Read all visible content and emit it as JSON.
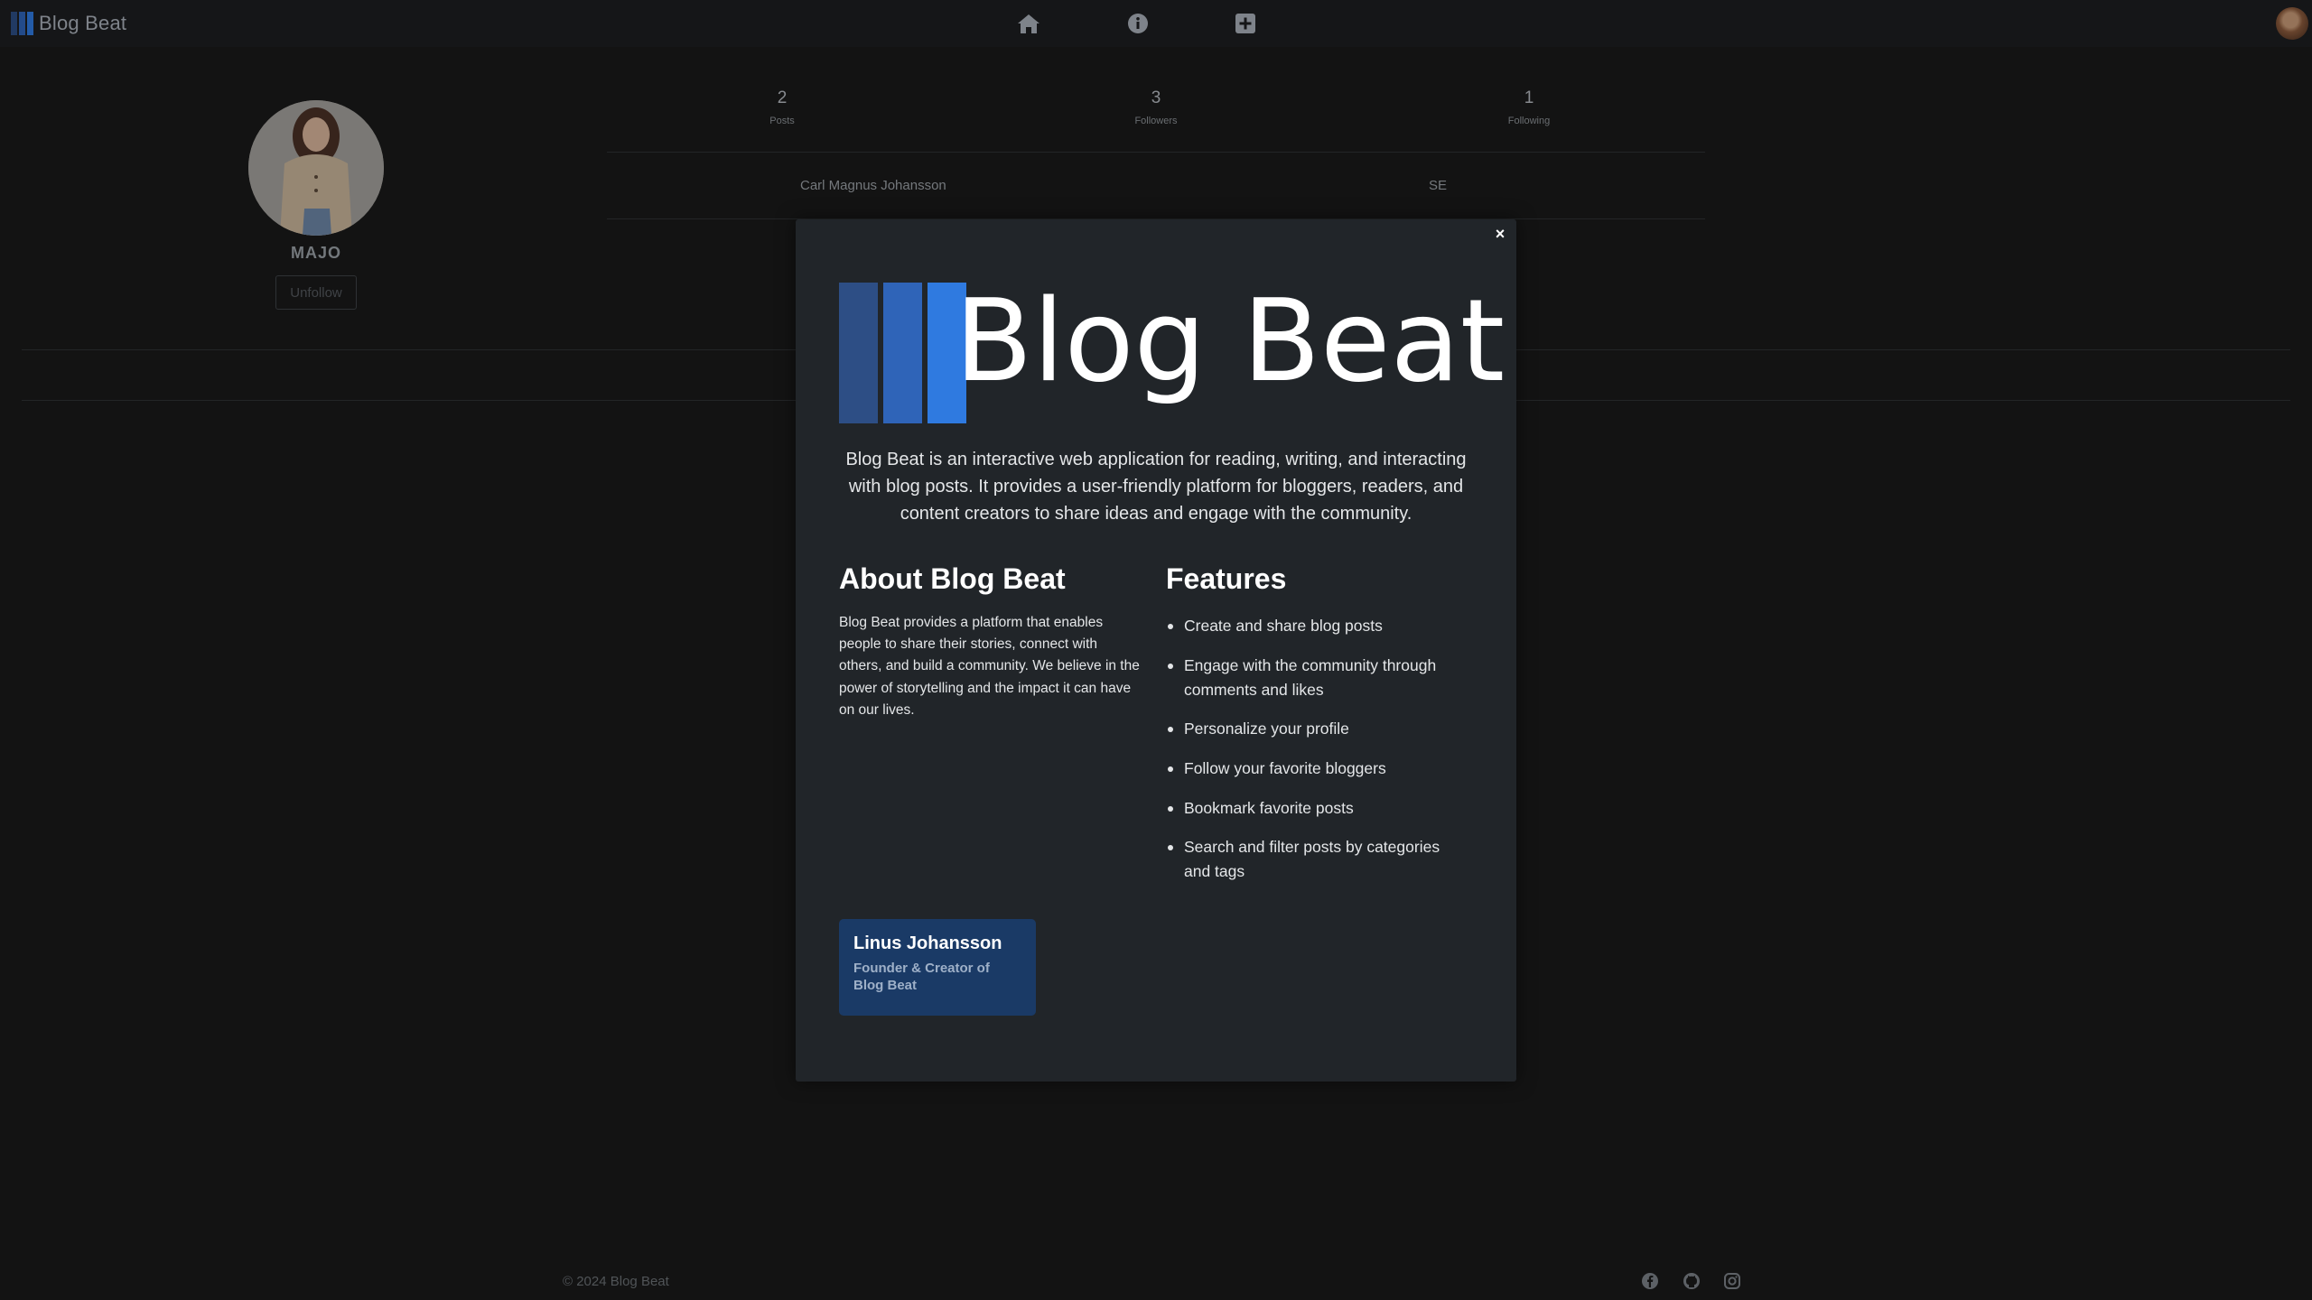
{
  "navbar": {
    "brand": "Blog Beat",
    "nav_icons": [
      "home-icon",
      "info-icon",
      "plus-square-icon"
    ]
  },
  "colors": {
    "bar1": "#2d4e85",
    "bar2": "#2f64b8",
    "bar3": "#2f7ae0",
    "founder_card": "#1a3a66",
    "modal_bg": "#212529"
  },
  "profile": {
    "username": "MAJO",
    "unfollow_label": "Unfollow",
    "stats": [
      {
        "value": "2",
        "label": "Posts"
      },
      {
        "value": "3",
        "label": "Followers"
      },
      {
        "value": "1",
        "label": "Following"
      }
    ],
    "full_name": "Carl Magnus Johansson",
    "country": "SE"
  },
  "modal": {
    "close_label": "×",
    "logo_text": "Blog Beat",
    "intro": "Blog Beat is an interactive web application for reading, writing, and interacting with blog posts. It provides a user-friendly platform for bloggers, readers, and content creators to share ideas and engage with the community.",
    "about_title": "About Blog Beat",
    "about_text": "Blog Beat provides a platform that enables people to share their stories, connect with others, and build a community. We believe in the power of storytelling and the impact it can have on our lives.",
    "features_title": "Features",
    "features": [
      "Create and share blog posts",
      "Engage with the community through comments and likes",
      "Personalize your profile",
      "Follow your favorite bloggers",
      "Bookmark favorite posts",
      "Search and filter posts by categories and tags"
    ],
    "founder": {
      "name": "Linus Johansson",
      "role": "Founder & Creator of Blog Beat"
    }
  },
  "footer": {
    "copyright": "© 2024 Blog Beat",
    "social_icons": [
      "facebook-icon",
      "github-icon",
      "instagram-icon"
    ]
  }
}
